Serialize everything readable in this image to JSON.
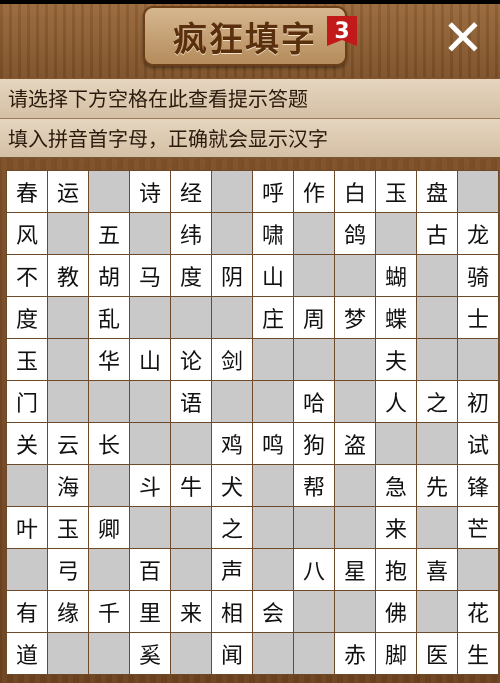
{
  "header": {
    "logo_text": "疯狂填字",
    "logo_badge": "3",
    "close_glyph": "✕"
  },
  "hints": {
    "line1": "请选择下方空格在此查看提示答题",
    "line2": "填入拼音首字母，正确就会显示汉字"
  },
  "grid": {
    "rows": [
      [
        "春",
        "运",
        "#",
        "诗",
        "经",
        "#",
        "呼",
        "作",
        "白",
        "玉",
        "盘",
        "#"
      ],
      [
        "风",
        "#",
        "五",
        "#",
        "纬",
        "#",
        "啸",
        "#",
        "鸽",
        "#",
        "古",
        "龙"
      ],
      [
        "不",
        "教",
        "胡",
        "马",
        "度",
        "阴",
        "山",
        "#",
        "#",
        "蝴",
        "#",
        "骑"
      ],
      [
        "度",
        "#",
        "乱",
        "#",
        "#",
        "#",
        "庄",
        "周",
        "梦",
        "蝶",
        "#",
        "士"
      ],
      [
        "玉",
        "#",
        "华",
        "山",
        "论",
        "剑",
        "#",
        "#",
        "#",
        "夫",
        "#",
        "#"
      ],
      [
        "门",
        "#",
        "#",
        "#",
        "语",
        "#",
        "#",
        "哈",
        "#",
        "人",
        "之",
        "初"
      ],
      [
        "关",
        "云",
        "长",
        "#",
        "#",
        "鸡",
        "鸣",
        "狗",
        "盗",
        "#",
        "#",
        "试"
      ],
      [
        "#",
        "海",
        "#",
        "斗",
        "牛",
        "犬",
        "#",
        "帮",
        "#",
        "急",
        "先",
        "锋"
      ],
      [
        "叶",
        "玉",
        "卿",
        "#",
        "#",
        "之",
        "#",
        "#",
        "#",
        "来",
        "#",
        "芒"
      ],
      [
        "#",
        "弓",
        "#",
        "百",
        "#",
        "声",
        "#",
        "八",
        "星",
        "抱",
        "喜",
        "#"
      ],
      [
        "有",
        "缘",
        "千",
        "里",
        "来",
        "相",
        "会",
        "#",
        "#",
        "佛",
        "#",
        "花"
      ],
      [
        "道",
        "#",
        "#",
        "奚",
        "#",
        "闻",
        "#",
        "#",
        "赤",
        "脚",
        "医",
        "生"
      ]
    ]
  }
}
